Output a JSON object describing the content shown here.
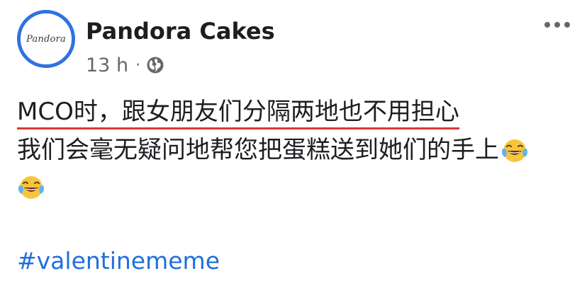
{
  "post": {
    "page_name": "Pandora Cakes",
    "avatar_text": "Pandora",
    "timestamp": "13 h",
    "separator": "·",
    "privacy_icon": "globe-icon",
    "more_icon": "more-options-icon",
    "line1": "MCO时，跟女朋友们分隔两地也不用担心",
    "line2": "我们会毫无疑问地帮您把蛋糕送到她们的手上",
    "emoji": "face-with-tears-of-joy-icon",
    "hashtag": "#valentinememe"
  },
  "colors": {
    "avatar_ring": "#2f72e0",
    "underline": "#d83a38",
    "hashtag": "#216fdb",
    "meta_text": "#65676b"
  }
}
